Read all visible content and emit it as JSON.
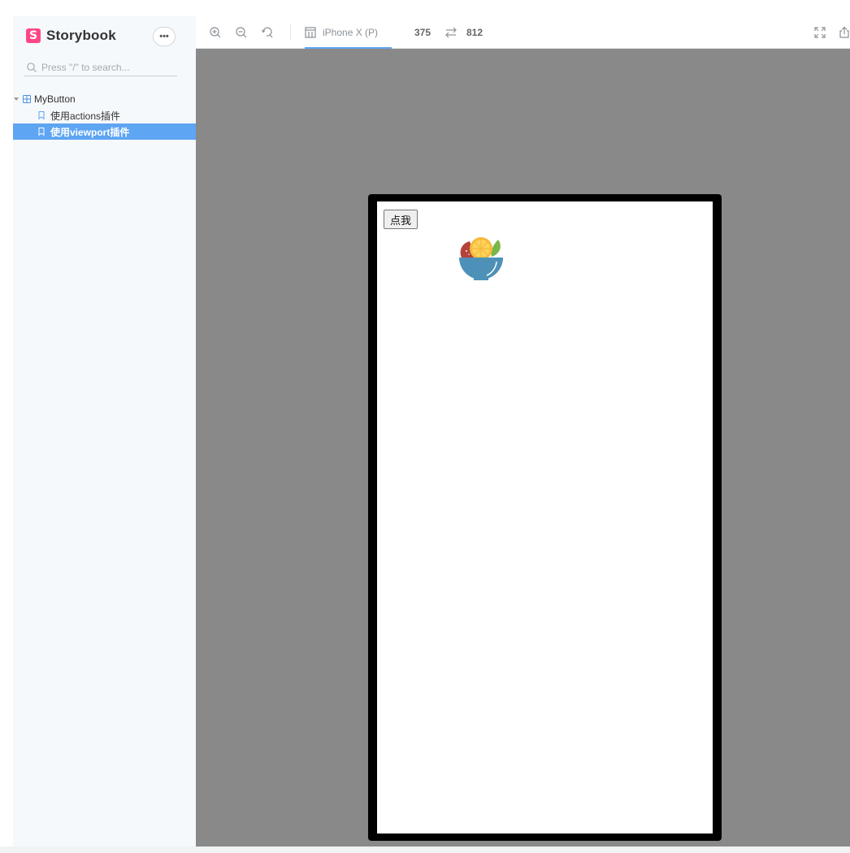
{
  "sidebar": {
    "brand": {
      "logo_letter": "S",
      "name": "Storybook",
      "logo_color": "#ff4785"
    },
    "menu_button_label": "•••",
    "search": {
      "placeholder": "Press \"/\" to search..."
    },
    "tree": {
      "group": {
        "label": "MyButton",
        "icon": "component-grid-icon",
        "expanded": true
      },
      "stories": [
        {
          "label": "使用actions插件",
          "icon": "bookmark-icon",
          "selected": false
        },
        {
          "label": "使用viewport插件",
          "icon": "bookmark-icon",
          "selected": true
        }
      ]
    },
    "selected_color": "#5ea5f3"
  },
  "toolbar": {
    "icons": [
      "zoom-in-icon",
      "zoom-out-icon",
      "zoom-reset-icon"
    ],
    "viewport": {
      "device_icon": "device-icon",
      "label": "iPhone X (P)",
      "width": "375",
      "swap_icon": "rotate-swap-icon",
      "height": "812"
    },
    "right_icons": [
      "fullscreen-icon",
      "share-icon"
    ]
  },
  "preview": {
    "background": "#898989",
    "story": {
      "button_label": "点我",
      "image": "fruit-bowl-logo"
    }
  }
}
